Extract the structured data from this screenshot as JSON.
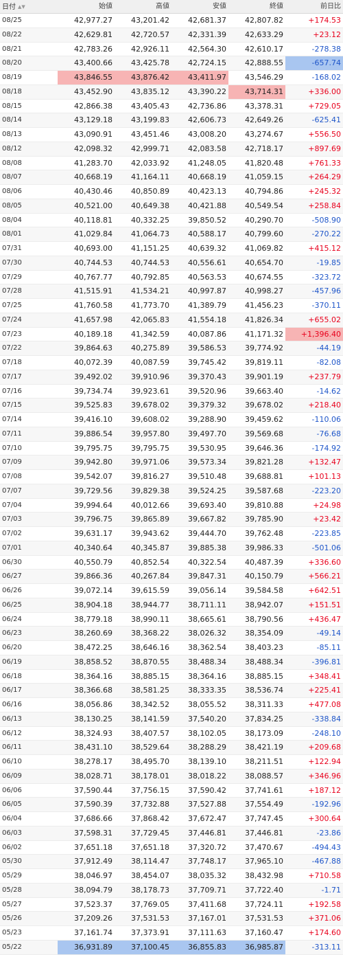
{
  "header": {
    "date": "日付",
    "open": "始値",
    "high": "高値",
    "low": "安値",
    "close": "終値",
    "change": "前日比"
  },
  "colors": {
    "up": "#e8001c",
    "down": "#1f56c9",
    "highlight_high": "#f7b4b4",
    "highlight_low": "#a9c6f0"
  },
  "rows": [
    {
      "date": "08/25",
      "open": "42,977.27",
      "high": "43,201.42",
      "low": "42,681.37",
      "close": "42,807.82",
      "change": "+174.53"
    },
    {
      "date": "08/22",
      "open": "42,629.81",
      "high": "42,720.57",
      "low": "42,331.39",
      "close": "42,633.29",
      "change": "+23.12"
    },
    {
      "date": "08/21",
      "open": "42,783.26",
      "high": "42,926.11",
      "low": "42,564.30",
      "close": "42,610.17",
      "change": "-278.38"
    },
    {
      "date": "08/20",
      "open": "43,400.66",
      "high": "43,425.78",
      "low": "42,724.15",
      "close": "42,888.55",
      "change": "-657.74",
      "hl": {
        "change": "blue"
      }
    },
    {
      "date": "08/19",
      "open": "43,846.55",
      "high": "43,876.42",
      "low": "43,411.97",
      "close": "43,546.29",
      "change": "-168.02",
      "hl": {
        "open": "red",
        "high": "red",
        "low": "red"
      }
    },
    {
      "date": "08/18",
      "open": "43,452.90",
      "high": "43,835.12",
      "low": "43,390.22",
      "close": "43,714.31",
      "change": "+336.00",
      "hl": {
        "close": "red"
      }
    },
    {
      "date": "08/15",
      "open": "42,866.38",
      "high": "43,405.43",
      "low": "42,736.86",
      "close": "43,378.31",
      "change": "+729.05"
    },
    {
      "date": "08/14",
      "open": "43,129.18",
      "high": "43,199.83",
      "low": "42,606.73",
      "close": "42,649.26",
      "change": "-625.41"
    },
    {
      "date": "08/13",
      "open": "43,090.91",
      "high": "43,451.46",
      "low": "43,008.20",
      "close": "43,274.67",
      "change": "+556.50"
    },
    {
      "date": "08/12",
      "open": "42,098.32",
      "high": "42,999.71",
      "low": "42,083.58",
      "close": "42,718.17",
      "change": "+897.69"
    },
    {
      "date": "08/08",
      "open": "41,283.70",
      "high": "42,033.92",
      "low": "41,248.05",
      "close": "41,820.48",
      "change": "+761.33"
    },
    {
      "date": "08/07",
      "open": "40,668.19",
      "high": "41,164.11",
      "low": "40,668.19",
      "close": "41,059.15",
      "change": "+264.29"
    },
    {
      "date": "08/06",
      "open": "40,430.46",
      "high": "40,850.89",
      "low": "40,423.13",
      "close": "40,794.86",
      "change": "+245.32"
    },
    {
      "date": "08/05",
      "open": "40,521.00",
      "high": "40,649.38",
      "low": "40,421.88",
      "close": "40,549.54",
      "change": "+258.84"
    },
    {
      "date": "08/04",
      "open": "40,118.81",
      "high": "40,332.25",
      "low": "39,850.52",
      "close": "40,290.70",
      "change": "-508.90"
    },
    {
      "date": "08/01",
      "open": "41,029.84",
      "high": "41,064.73",
      "low": "40,588.17",
      "close": "40,799.60",
      "change": "-270.22"
    },
    {
      "date": "07/31",
      "open": "40,693.00",
      "high": "41,151.25",
      "low": "40,639.32",
      "close": "41,069.82",
      "change": "+415.12"
    },
    {
      "date": "07/30",
      "open": "40,744.53",
      "high": "40,744.53",
      "low": "40,556.61",
      "close": "40,654.70",
      "change": "-19.85"
    },
    {
      "date": "07/29",
      "open": "40,767.77",
      "high": "40,792.85",
      "low": "40,563.53",
      "close": "40,674.55",
      "change": "-323.72"
    },
    {
      "date": "07/28",
      "open": "41,515.91",
      "high": "41,534.21",
      "low": "40,997.87",
      "close": "40,998.27",
      "change": "-457.96"
    },
    {
      "date": "07/25",
      "open": "41,760.58",
      "high": "41,773.70",
      "low": "41,389.79",
      "close": "41,456.23",
      "change": "-370.11"
    },
    {
      "date": "07/24",
      "open": "41,657.98",
      "high": "42,065.83",
      "low": "41,554.18",
      "close": "41,826.34",
      "change": "+655.02"
    },
    {
      "date": "07/23",
      "open": "40,189.18",
      "high": "41,342.59",
      "low": "40,087.86",
      "close": "41,171.32",
      "change": "+1,396.40",
      "hl": {
        "change": "red"
      }
    },
    {
      "date": "07/22",
      "open": "39,864.63",
      "high": "40,275.89",
      "low": "39,586.53",
      "close": "39,774.92",
      "change": "-44.19"
    },
    {
      "date": "07/18",
      "open": "40,072.39",
      "high": "40,087.59",
      "low": "39,745.42",
      "close": "39,819.11",
      "change": "-82.08"
    },
    {
      "date": "07/17",
      "open": "39,492.02",
      "high": "39,910.96",
      "low": "39,370.43",
      "close": "39,901.19",
      "change": "+237.79"
    },
    {
      "date": "07/16",
      "open": "39,734.74",
      "high": "39,923.61",
      "low": "39,520.96",
      "close": "39,663.40",
      "change": "-14.62"
    },
    {
      "date": "07/15",
      "open": "39,525.83",
      "high": "39,678.02",
      "low": "39,379.32",
      "close": "39,678.02",
      "change": "+218.40"
    },
    {
      "date": "07/14",
      "open": "39,416.10",
      "high": "39,608.02",
      "low": "39,288.90",
      "close": "39,459.62",
      "change": "-110.06"
    },
    {
      "date": "07/11",
      "open": "39,886.54",
      "high": "39,957.80",
      "low": "39,497.70",
      "close": "39,569.68",
      "change": "-76.68"
    },
    {
      "date": "07/10",
      "open": "39,795.75",
      "high": "39,795.75",
      "low": "39,530.95",
      "close": "39,646.36",
      "change": "-174.92"
    },
    {
      "date": "07/09",
      "open": "39,942.80",
      "high": "39,971.06",
      "low": "39,573.34",
      "close": "39,821.28",
      "change": "+132.47"
    },
    {
      "date": "07/08",
      "open": "39,542.07",
      "high": "39,816.27",
      "low": "39,510.48",
      "close": "39,688.81",
      "change": "+101.13"
    },
    {
      "date": "07/07",
      "open": "39,729.56",
      "high": "39,829.38",
      "low": "39,524.25",
      "close": "39,587.68",
      "change": "-223.20"
    },
    {
      "date": "07/04",
      "open": "39,994.64",
      "high": "40,012.66",
      "low": "39,693.40",
      "close": "39,810.88",
      "change": "+24.98"
    },
    {
      "date": "07/03",
      "open": "39,796.75",
      "high": "39,865.89",
      "low": "39,667.82",
      "close": "39,785.90",
      "change": "+23.42"
    },
    {
      "date": "07/02",
      "open": "39,631.17",
      "high": "39,943.62",
      "low": "39,444.70",
      "close": "39,762.48",
      "change": "-223.85"
    },
    {
      "date": "07/01",
      "open": "40,340.64",
      "high": "40,345.87",
      "low": "39,885.38",
      "close": "39,986.33",
      "change": "-501.06"
    },
    {
      "date": "06/30",
      "open": "40,550.79",
      "high": "40,852.54",
      "low": "40,322.54",
      "close": "40,487.39",
      "change": "+336.60"
    },
    {
      "date": "06/27",
      "open": "39,866.36",
      "high": "40,267.84",
      "low": "39,847.31",
      "close": "40,150.79",
      "change": "+566.21"
    },
    {
      "date": "06/26",
      "open": "39,072.14",
      "high": "39,615.59",
      "low": "39,056.14",
      "close": "39,584.58",
      "change": "+642.51"
    },
    {
      "date": "06/25",
      "open": "38,904.18",
      "high": "38,944.77",
      "low": "38,711.11",
      "close": "38,942.07",
      "change": "+151.51"
    },
    {
      "date": "06/24",
      "open": "38,779.18",
      "high": "38,990.11",
      "low": "38,665.61",
      "close": "38,790.56",
      "change": "+436.47"
    },
    {
      "date": "06/23",
      "open": "38,260.69",
      "high": "38,368.22",
      "low": "38,026.32",
      "close": "38,354.09",
      "change": "-49.14"
    },
    {
      "date": "06/20",
      "open": "38,472.25",
      "high": "38,646.16",
      "low": "38,362.54",
      "close": "38,403.23",
      "change": "-85.11"
    },
    {
      "date": "06/19",
      "open": "38,858.52",
      "high": "38,870.55",
      "low": "38,488.34",
      "close": "38,488.34",
      "change": "-396.81"
    },
    {
      "date": "06/18",
      "open": "38,364.16",
      "high": "38,885.15",
      "low": "38,364.16",
      "close": "38,885.15",
      "change": "+348.41"
    },
    {
      "date": "06/17",
      "open": "38,366.68",
      "high": "38,581.25",
      "low": "38,333.35",
      "close": "38,536.74",
      "change": "+225.41"
    },
    {
      "date": "06/16",
      "open": "38,056.86",
      "high": "38,342.52",
      "low": "38,055.52",
      "close": "38,311.33",
      "change": "+477.08"
    },
    {
      "date": "06/13",
      "open": "38,130.25",
      "high": "38,141.59",
      "low": "37,540.20",
      "close": "37,834.25",
      "change": "-338.84"
    },
    {
      "date": "06/12",
      "open": "38,324.93",
      "high": "38,407.57",
      "low": "38,102.05",
      "close": "38,173.09",
      "change": "-248.10"
    },
    {
      "date": "06/11",
      "open": "38,431.10",
      "high": "38,529.64",
      "low": "38,288.29",
      "close": "38,421.19",
      "change": "+209.68"
    },
    {
      "date": "06/10",
      "open": "38,278.17",
      "high": "38,495.70",
      "low": "38,139.10",
      "close": "38,211.51",
      "change": "+122.94"
    },
    {
      "date": "06/09",
      "open": "38,028.71",
      "high": "38,178.01",
      "low": "38,018.22",
      "close": "38,088.57",
      "change": "+346.96"
    },
    {
      "date": "06/06",
      "open": "37,590.44",
      "high": "37,756.15",
      "low": "37,590.42",
      "close": "37,741.61",
      "change": "+187.12"
    },
    {
      "date": "06/05",
      "open": "37,590.39",
      "high": "37,732.88",
      "low": "37,527.88",
      "close": "37,554.49",
      "change": "-192.96"
    },
    {
      "date": "06/04",
      "open": "37,686.66",
      "high": "37,868.42",
      "low": "37,672.47",
      "close": "37,747.45",
      "change": "+300.64"
    },
    {
      "date": "06/03",
      "open": "37,598.31",
      "high": "37,729.45",
      "low": "37,446.81",
      "close": "37,446.81",
      "change": "-23.86"
    },
    {
      "date": "06/02",
      "open": "37,651.18",
      "high": "37,651.18",
      "low": "37,320.72",
      "close": "37,470.67",
      "change": "-494.43"
    },
    {
      "date": "05/30",
      "open": "37,912.49",
      "high": "38,114.47",
      "low": "37,748.17",
      "close": "37,965.10",
      "change": "-467.88"
    },
    {
      "date": "05/29",
      "open": "38,046.97",
      "high": "38,454.07",
      "low": "38,035.32",
      "close": "38,432.98",
      "change": "+710.58"
    },
    {
      "date": "05/28",
      "open": "38,094.79",
      "high": "38,178.73",
      "low": "37,709.71",
      "close": "37,722.40",
      "change": "-1.71"
    },
    {
      "date": "05/27",
      "open": "37,523.37",
      "high": "37,769.05",
      "low": "37,411.68",
      "close": "37,724.11",
      "change": "+192.58"
    },
    {
      "date": "05/26",
      "open": "37,209.26",
      "high": "37,531.53",
      "low": "37,167.01",
      "close": "37,531.53",
      "change": "+371.06"
    },
    {
      "date": "05/23",
      "open": "37,161.74",
      "high": "37,373.91",
      "low": "37,111.63",
      "close": "37,160.47",
      "change": "+174.60"
    },
    {
      "date": "05/22",
      "open": "36,931.89",
      "high": "37,100.45",
      "low": "36,855.83",
      "close": "36,985.87",
      "change": "-313.11",
      "hl": {
        "open": "blue",
        "high": "blue",
        "low": "blue",
        "close": "blue"
      }
    }
  ]
}
